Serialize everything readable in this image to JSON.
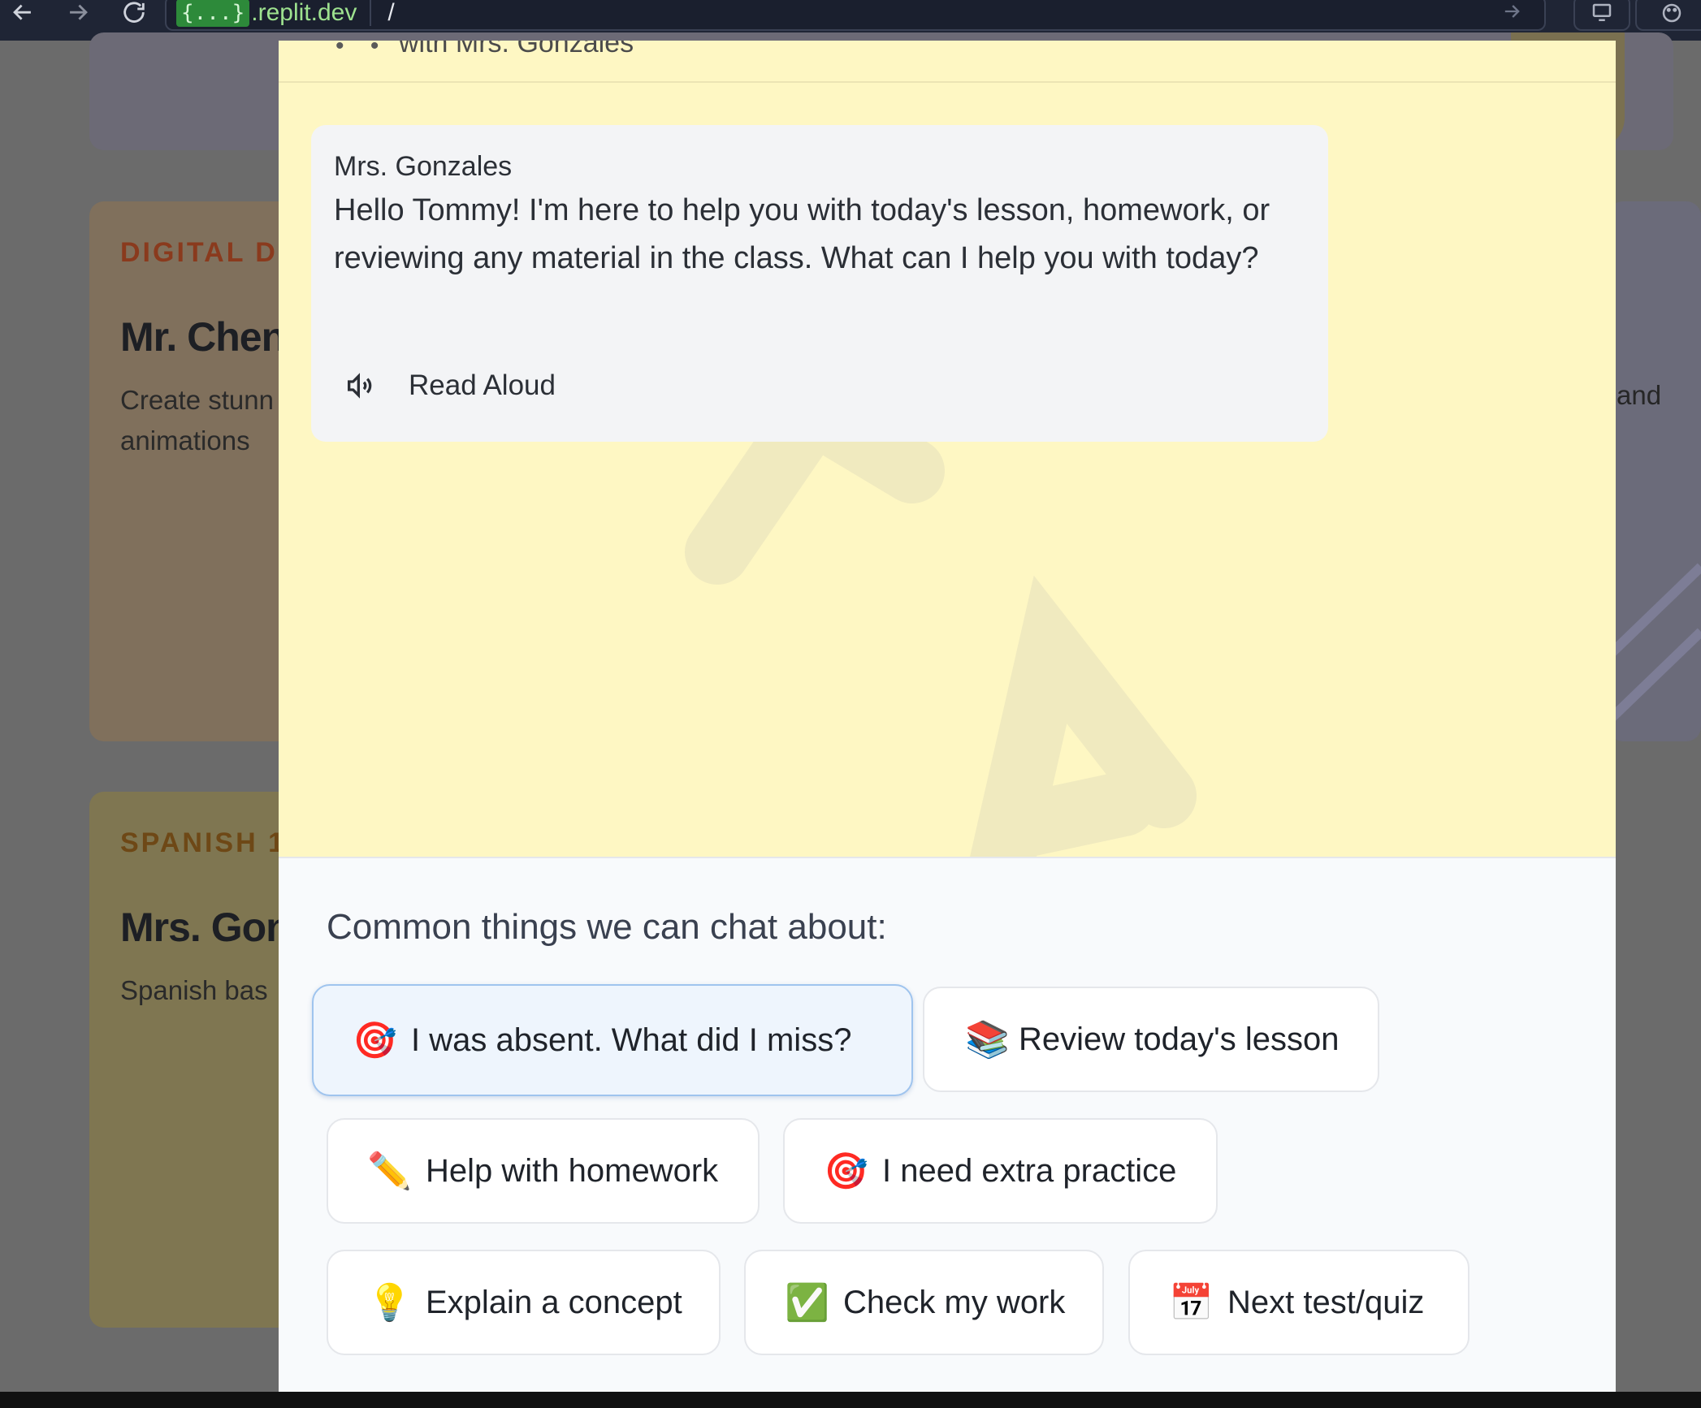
{
  "browser": {
    "url_badge": "{...}",
    "url_host": ".replit.dev",
    "url_path": "/"
  },
  "background_cards": {
    "digital": {
      "label": "DIGITAL DE",
      "teacher": "Mr. Chen",
      "description": "Create stunn",
      "description_line2": "animations",
      "right_snippet": "and"
    },
    "spanish": {
      "label": "SPANISH 1",
      "teacher": "Mrs. Gon",
      "description": "Spanish bas"
    }
  },
  "modal": {
    "header_snippet": "with Mrs. Gonzales",
    "message": {
      "sender": "Mrs. Gonzales",
      "text": "Hello Tommy! I'm here to help you with today's lesson, homework, or reviewing any material in the class. What can I help you with today?",
      "read_aloud_label": "Read Aloud"
    },
    "suggestions": {
      "title": "Common things we can chat about:",
      "items": [
        {
          "emoji": "🎯",
          "label": "I was absent. What did I miss?"
        },
        {
          "emoji": "📚",
          "label": "Review today's lesson"
        },
        {
          "emoji": "✏️",
          "label": "Help with homework"
        },
        {
          "emoji": "🎯",
          "label": "I need extra practice"
        },
        {
          "emoji": "💡",
          "label": "Explain a concept"
        },
        {
          "emoji": "✅",
          "label": "Check my work"
        },
        {
          "emoji": "📅",
          "label": "Next test/quiz"
        }
      ]
    }
  }
}
